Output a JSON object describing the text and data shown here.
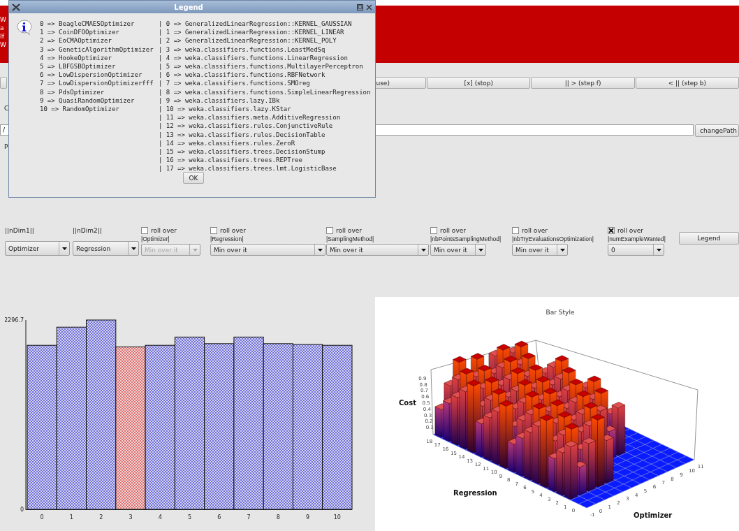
{
  "legend_dialog": {
    "title": "Legend",
    "optimizers": [
      "0 => BeagleCMAESOptimizer",
      "1 => CoinDFOOptimizer",
      "2 => EoCMAOptimizer",
      "3 => GeneticAlgorithmOptimizer",
      "4 => HookeOptimizer",
      "5 => LBFGSBOptimizer",
      "6 => LowDispersionOptimizer",
      "7 => LowDispersionOptimizerfff",
      "8 => PdsOptimizer",
      "9 => QuasiRandomOptimizer",
      "10 => RandomOptimizer"
    ],
    "regressions": [
      "| 0 => GeneralizedLinearRegression::KERNEL_GAUSSIAN",
      "| 1 => GeneralizedLinearRegression::KERNEL_LINEAR",
      "| 2 => GeneralizedLinearRegression::KERNEL_POLY",
      "| 3 => weka.classifiers.functions.LeastMedSq",
      "| 4 => weka.classifiers.functions.LinearRegression",
      "| 5 => weka.classifiers.functions.MultilayerPerceptron",
      "| 6 => weka.classifiers.functions.RBFNetwork",
      "| 7 => weka.classifiers.functions.SMOreg",
      "| 8 => weka.classifiers.functions.SimpleLinearRegression",
      "| 9 => weka.classifiers.lazy.IBk",
      "| 10 => weka.classifiers.lazy.KStar",
      "| 11 => weka.classifiers.meta.AdditiveRegression",
      "| 12 => weka.classifiers.rules.ConjunctiveRule",
      "| 13 => weka.classifiers.rules.DecisionTable",
      "| 14 => weka.classifiers.rules.ZeroR",
      "| 15 => weka.classifiers.trees.DecisionStump",
      "| 16 => weka.classifiers.trees.REPTree",
      "| 17 => weka.classifiers.trees.lmt.LogisticBase"
    ],
    "ok_button": "OK"
  },
  "banner_fragments": [
    "W",
    "a",
    "If",
    "W"
  ],
  "toolbar": {
    "buttons": [
      "use)",
      "[x] (stop)",
      "|| > (step f)",
      "< || (step b)"
    ]
  },
  "label_fragments": [
    "C",
    "P"
  ],
  "path_field": {
    "value": "/"
  },
  "change_path_button": "changePath",
  "controls": [
    {
      "kind": "dimension",
      "label": "||nDim1||",
      "value": "Optimizer",
      "disabled": false
    },
    {
      "kind": "dimension",
      "label": "||nDim2||",
      "value": "Regression",
      "disabled": false
    },
    {
      "kind": "filter",
      "roll_over": false,
      "roll_over_label": "roll over",
      "label": "|Optimizer|",
      "value": "Min over it",
      "disabled": true
    },
    {
      "kind": "filter",
      "roll_over": false,
      "roll_over_label": "roll over",
      "label": "|Regression|",
      "value": "Min over it",
      "disabled": false
    },
    {
      "kind": "filter",
      "roll_over": false,
      "roll_over_label": "roll over",
      "label": "|SamplingMethod|",
      "value": "Min over it",
      "disabled": false
    },
    {
      "kind": "filter",
      "roll_over": false,
      "roll_over_label": "roll over",
      "label": "|nbPointsSamplingMethod|",
      "value": "Min over it",
      "disabled": false
    },
    {
      "kind": "filter",
      "roll_over": false,
      "roll_over_label": "roll over",
      "label": "|nbTryEvaluationsOptimization|",
      "value": "Min over it",
      "disabled": false
    },
    {
      "kind": "filter",
      "roll_over": true,
      "roll_over_label": "roll over",
      "label": "|numExampleWanted|",
      "value": "0",
      "disabled": false
    }
  ],
  "legend_button": "Legend",
  "bar_chart": {
    "selected_category": "3",
    "chart_data": {
      "type": "bar",
      "categories": [
        "0",
        "1",
        "2",
        "3",
        "4",
        "5",
        "6",
        "7",
        "8",
        "9",
        "10"
      ],
      "values": [
        1990,
        2210,
        2296.7,
        1970,
        1990,
        2090,
        2010,
        2090,
        2010,
        2000,
        1990
      ],
      "ylim": [
        0,
        2296.7
      ],
      "yticks": [
        {
          "value": 0,
          "label": "0"
        },
        {
          "value": 2296.7,
          "label": "2296.7"
        }
      ]
    }
  },
  "bar_3d_chart": {
    "title": "Bar Style",
    "z_label": "Cost",
    "z_ticks": [
      "0.9",
      "0.8",
      "0.7",
      "0.6",
      "0.5",
      "0.4",
      "0.3",
      "0.2",
      "0.1"
    ],
    "y_label": "Regression",
    "y_ticks": [
      "0",
      "1",
      "2",
      "3",
      "4",
      "5",
      "6",
      "7",
      "8",
      "9",
      "10",
      "11",
      "12",
      "13",
      "14",
      "15",
      "16",
      "17",
      "18"
    ],
    "x_label": "Optimizer",
    "x_ticks": [
      "-1",
      "0",
      "1",
      "2",
      "3",
      "4",
      "5",
      "6",
      "7",
      "8",
      "9",
      "10",
      "11"
    ]
  }
}
